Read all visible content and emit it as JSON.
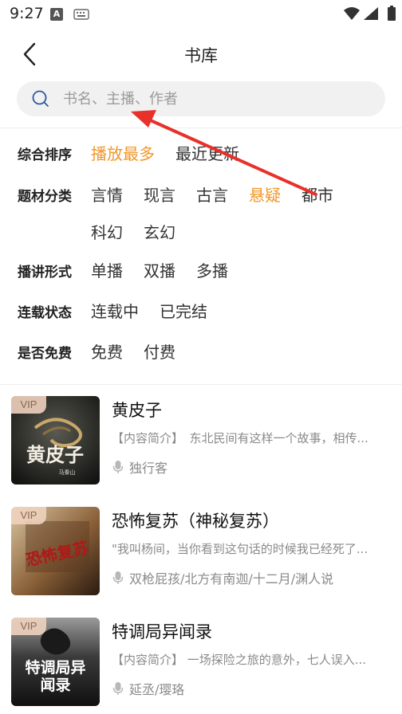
{
  "status": {
    "time": "9:27",
    "a_glyph": "A"
  },
  "header": {
    "title": "书库"
  },
  "search": {
    "placeholder": "书名、主播、作者"
  },
  "filters": [
    {
      "label": "综合排序",
      "options": [
        "播放最多",
        "最近更新"
      ],
      "active": 0
    },
    {
      "label": "题材分类",
      "options": [
        "言情",
        "现言",
        "古言",
        "悬疑",
        "都市",
        "科幻",
        "玄幻"
      ],
      "active": 3
    },
    {
      "label": "播讲形式",
      "options": [
        "单播",
        "双播",
        "多播"
      ],
      "active": -1
    },
    {
      "label": "连载状态",
      "options": [
        "连载中",
        "已完结"
      ],
      "active": -1
    },
    {
      "label": "是否免费",
      "options": [
        "免费",
        "付费"
      ],
      "active": -1
    }
  ],
  "books": [
    {
      "badge": "VIP",
      "title": "黄皮子",
      "desc": "【内容简介】　东北民间有这样一个故事，相传...",
      "author": "独行客",
      "cover_text": "黄皮子",
      "cover_sub": "马秦山"
    },
    {
      "badge": "VIP",
      "title": "恐怖复苏（神秘复苏）",
      "desc": "\"我叫杨间，当你看到这句话的时候我已经死了...",
      "author": "双枪屁孩/北方有南迦/十二月/渊人说",
      "cover_text": "恐怖复苏",
      "cover_sub": ""
    },
    {
      "badge": "VIP",
      "title": "特调局异闻录",
      "desc": "【内容简介】 一场探险之旅的意外，七人误入...",
      "author": "延丞/璎珞",
      "cover_text": "特调局异闻录",
      "cover_sub": ""
    }
  ],
  "colors": {
    "accent": "#f0962a",
    "annotation": "#e8312a"
  }
}
